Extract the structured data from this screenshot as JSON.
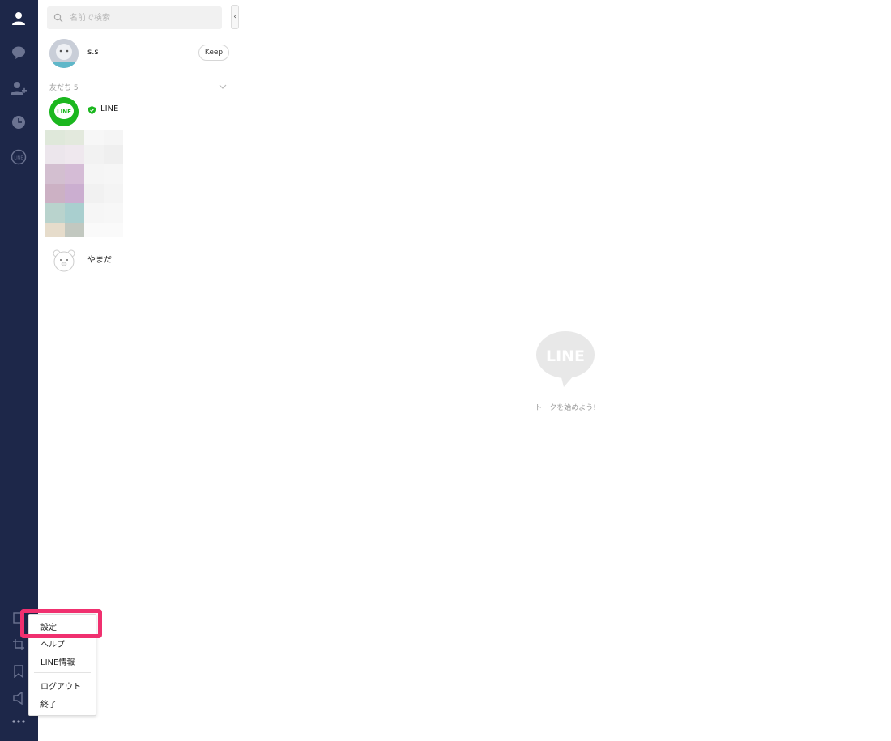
{
  "search": {
    "placeholder": "名前で検索"
  },
  "collapse": {
    "label": "‹"
  },
  "profile": {
    "name": "s.s",
    "keep_label": "Keep"
  },
  "friends": {
    "header": "友だち 5",
    "items": [
      {
        "name": "LINE",
        "official": true
      },
      {
        "name": "やまだ"
      }
    ]
  },
  "main": {
    "logo_text": "LINE",
    "message": "トークを始めよう!"
  },
  "rail_icons": [
    "person-icon",
    "chat-icon",
    "add-friend-icon",
    "clock-icon",
    "line-icon",
    "new-window-icon",
    "crop-icon",
    "bookmark-icon",
    "speaker-icon",
    "more-icon"
  ],
  "menu": {
    "items": [
      "設定",
      "ヘルプ",
      "LINE情報",
      "ログアウト",
      "終了"
    ]
  },
  "colors": {
    "rail": "#1d2749",
    "line_green": "#1bb71f",
    "highlight": "#f0306f"
  }
}
